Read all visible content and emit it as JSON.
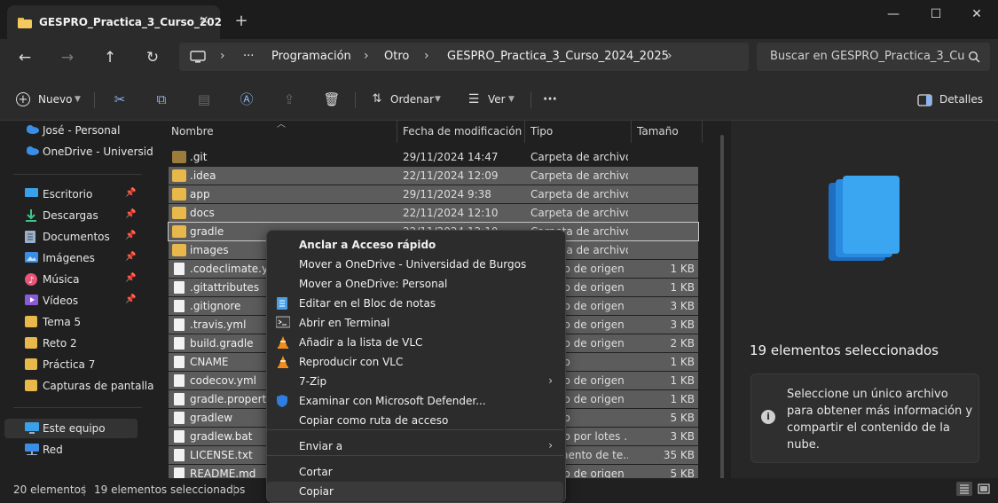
{
  "window": {
    "tab_title": "GESPRO_Practica_3_Curso_202",
    "tab_close": "✕",
    "new_tab": "+",
    "minimize": "—",
    "maximize": "☐",
    "close": "✕"
  },
  "nav": {
    "back": "←",
    "forward": "→",
    "up": "↑",
    "refresh": "↻"
  },
  "address": {
    "crumbs": [
      "Programación",
      "Otro",
      "GESPRO_Practica_3_Curso_2024_2025"
    ],
    "ellipsis": "···",
    "sep": "›"
  },
  "search": {
    "placeholder": "Buscar en GESPRO_Practica_3_Cu",
    "icon": "search-icon"
  },
  "toolbar": {
    "new_label": "Nuevo",
    "sort_label": "Ordenar",
    "view_label": "Ver",
    "more": "···",
    "details_label": "Detalles"
  },
  "sidebar": {
    "items": [
      {
        "label": "José - Personal",
        "icon": "cloud-icon"
      },
      {
        "label": "OneDrive - Universid",
        "icon": "cloud-icon"
      },
      {
        "label": "Escritorio",
        "icon": "desktop-icon"
      },
      {
        "label": "Descargas",
        "icon": "download-icon"
      },
      {
        "label": "Documentos",
        "icon": "document-icon"
      },
      {
        "label": "Imágenes",
        "icon": "picture-icon"
      },
      {
        "label": "Música",
        "icon": "music-icon"
      },
      {
        "label": "Vídeos",
        "icon": "video-icon"
      },
      {
        "label": "Tema 5",
        "icon": "folder-icon"
      },
      {
        "label": "Reto 2",
        "icon": "folder-icon"
      },
      {
        "label": "Práctica 7",
        "icon": "folder-icon"
      },
      {
        "label": "Capturas de pantalla",
        "icon": "folder-icon"
      },
      {
        "label": "Este equipo",
        "icon": "computer-icon"
      },
      {
        "label": "Red",
        "icon": "network-icon"
      }
    ]
  },
  "columns": {
    "name": "Nombre",
    "date": "Fecha de modificación",
    "type": "Tipo",
    "size": "Tamaño"
  },
  "files": [
    {
      "name": ".git",
      "date": "29/11/2024 14:47",
      "type": "Carpeta de archivos",
      "size": "",
      "folder": true,
      "selected": false
    },
    {
      "name": ".idea",
      "date": "22/11/2024 12:09",
      "type": "Carpeta de archivos",
      "size": "",
      "folder": true,
      "selected": true
    },
    {
      "name": "app",
      "date": "29/11/2024 9:38",
      "type": "Carpeta de archivos",
      "size": "",
      "folder": true,
      "selected": true
    },
    {
      "name": "docs",
      "date": "22/11/2024 12:10",
      "type": "Carpeta de archivos",
      "size": "",
      "folder": true,
      "selected": true
    },
    {
      "name": "gradle",
      "date": "22/11/2024 12:10",
      "type": "Carpeta de archivos",
      "size": "",
      "folder": true,
      "selected": true
    },
    {
      "name": "images",
      "date": "",
      "type": "Carpeta de archivos",
      "size": "",
      "folder": true,
      "selected": true
    },
    {
      "name": ".codeclimate.yml",
      "date": "",
      "type": "Archivo de origen ...",
      "size": "1 KB",
      "folder": false,
      "selected": true
    },
    {
      "name": ".gitattributes",
      "date": "",
      "type": "Archivo de origen ...",
      "size": "1 KB",
      "folder": false,
      "selected": true
    },
    {
      "name": ".gitignore",
      "date": "",
      "type": "Archivo de origen ...",
      "size": "3 KB",
      "folder": false,
      "selected": true
    },
    {
      "name": ".travis.yml",
      "date": "",
      "type": "Archivo de origen ...",
      "size": "3 KB",
      "folder": false,
      "selected": true
    },
    {
      "name": "build.gradle",
      "date": "",
      "type": "Archivo de origen ...",
      "size": "2 KB",
      "folder": false,
      "selected": true
    },
    {
      "name": "CNAME",
      "date": "",
      "type": "Archivo",
      "size": "1 KB",
      "folder": false,
      "selected": true
    },
    {
      "name": "codecov.yml",
      "date": "",
      "type": "Archivo de origen ...",
      "size": "1 KB",
      "folder": false,
      "selected": true
    },
    {
      "name": "gradle.properties",
      "date": "",
      "type": "Archivo de origen ...",
      "size": "1 KB",
      "folder": false,
      "selected": true
    },
    {
      "name": "gradlew",
      "date": "",
      "type": "Archivo",
      "size": "5 KB",
      "folder": false,
      "selected": true
    },
    {
      "name": "gradlew.bat",
      "date": "",
      "type": "Archivo por lotes ...",
      "size": "3 KB",
      "folder": false,
      "selected": true
    },
    {
      "name": "LICENSE.txt",
      "date": "",
      "type": "Documento de te...",
      "size": "35 KB",
      "folder": false,
      "selected": true
    },
    {
      "name": "README.md",
      "date": "",
      "type": "Archivo de origen ...",
      "size": "5 KB",
      "folder": false,
      "selected": true
    }
  ],
  "context_menu": {
    "items": [
      {
        "label": "Anclar a Acceso rápido",
        "icon": "",
        "bold": true
      },
      {
        "label": "Mover a OneDrive - Universidad de Burgos",
        "icon": ""
      },
      {
        "label": "Mover a OneDrive: Personal",
        "icon": ""
      },
      {
        "label": "Editar en el Bloc de notas",
        "icon": "notepad-icon"
      },
      {
        "label": "Abrir en Terminal",
        "icon": "terminal-icon"
      },
      {
        "label": "Añadir a la lista de VLC",
        "icon": "vlc-icon"
      },
      {
        "label": "Reproducir con VLC",
        "icon": "vlc-icon"
      },
      {
        "label": "7-Zip",
        "icon": "",
        "submenu": true
      },
      {
        "label": "Examinar con Microsoft Defender...",
        "icon": "shield-icon"
      },
      {
        "label": "Copiar como ruta de acceso",
        "icon": ""
      },
      {
        "label": "Enviar a",
        "icon": "",
        "submenu": true
      },
      {
        "label": "Cortar",
        "icon": ""
      },
      {
        "label": "Copiar",
        "icon": ""
      }
    ],
    "arrow": "›"
  },
  "details": {
    "selection_title": "19 elementos seleccionados",
    "info_text": "Seleccione un único archivo para obtener más información y compartir el contenido de la nube.",
    "info_icon": "i"
  },
  "status": {
    "items_count": "20 elementos",
    "selected_count": "19 elementos seleccionados",
    "sep": "|"
  }
}
